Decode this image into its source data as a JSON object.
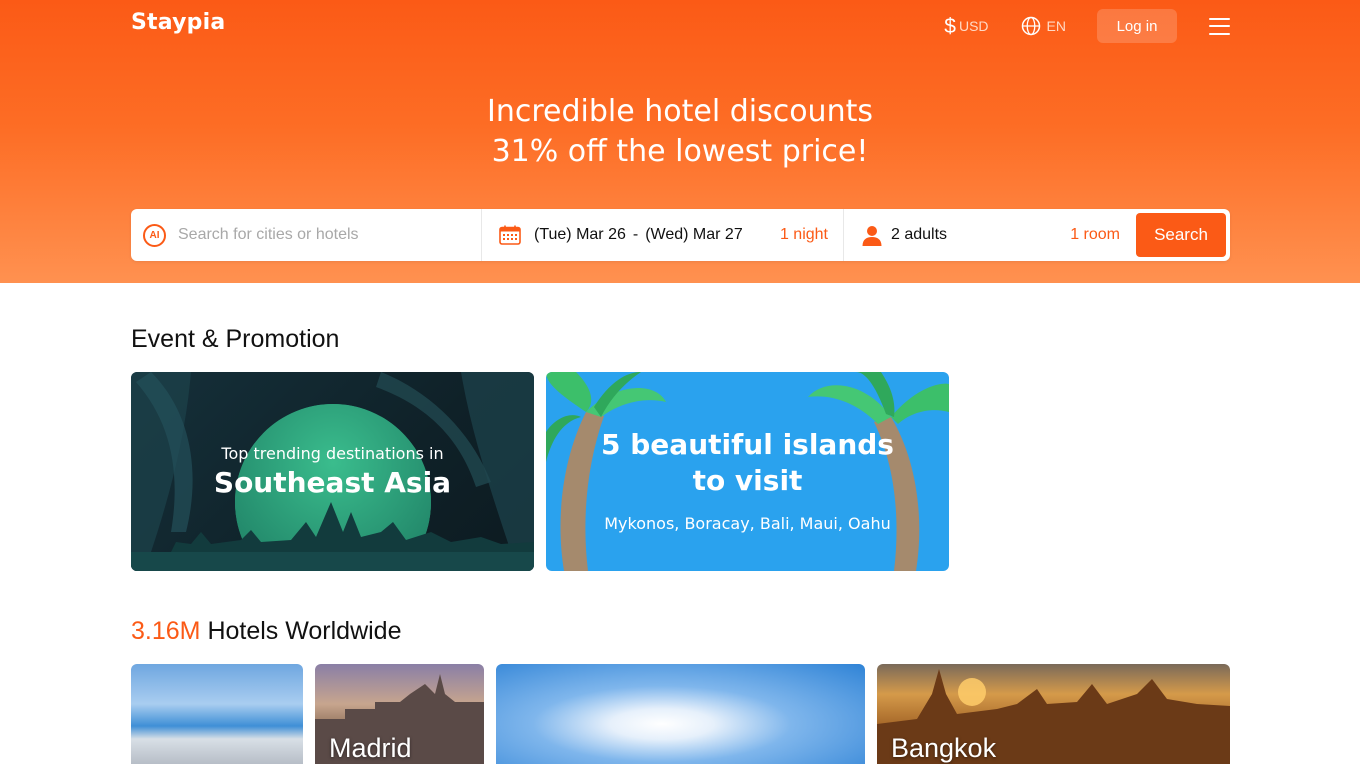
{
  "header": {
    "logo": "Staypia",
    "currency_symbol": "$",
    "currency": "USD",
    "language": "EN",
    "login_label": "Log in"
  },
  "hero": {
    "headline_line1": "Incredible hotel discounts",
    "headline_line2": "31% off the lowest price!"
  },
  "search": {
    "ai_badge": "AI",
    "placeholder": "Search for cities or hotels",
    "checkin": "(Tue) Mar 26",
    "separator": "-",
    "checkout": "(Wed) Mar 27",
    "nights": "1 night",
    "guests": "2 adults",
    "rooms": "1 room",
    "button_label": "Search"
  },
  "promotions": {
    "title": "Event & Promotion",
    "cards": [
      {
        "subtitle": "Top trending destinations in",
        "title": "Southeast Asia"
      },
      {
        "title_line1": "5 beautiful islands",
        "title_line2": "to visit",
        "subtitle": "Mykonos, Boracay, Bali, Maui, Oahu"
      }
    ]
  },
  "hotels": {
    "count": "3.16M",
    "title": "Hotels Worldwide",
    "cities": [
      {
        "label": ""
      },
      {
        "label": "Madrid"
      },
      {
        "label": ""
      },
      {
        "label": "Bangkok"
      }
    ]
  },
  "colors": {
    "brand": "#fb5a16",
    "promo_dark": "#0f2128",
    "promo_blue": "#2aa2ee"
  }
}
